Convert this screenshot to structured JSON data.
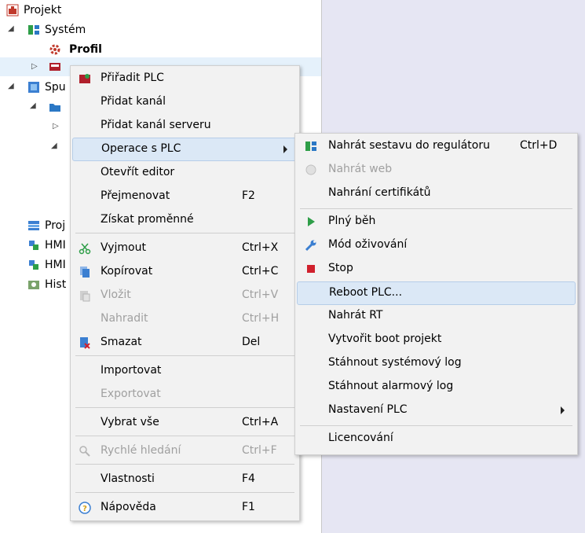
{
  "tree": {
    "root": "Projekt",
    "system": "Systém",
    "profile": "Profil",
    "spu": "Spu",
    "proj": "Proj",
    "hm1": "HMI",
    "hm2": "HMI",
    "hist": "Hist"
  },
  "context_menu": {
    "assign_plc": "Přiřadit PLC",
    "add_channel": "Přidat kanál",
    "add_server_channel": "Přidat kanál serveru",
    "plc_operations": "Operace s PLC",
    "open_editor": "Otevřít editor",
    "rename": "Přejmenovat",
    "rename_sc": "F2",
    "get_variables": "Získat proměnné",
    "cut": "Vyjmout",
    "cut_sc": "Ctrl+X",
    "copy": "Kopírovat",
    "copy_sc": "Ctrl+C",
    "paste": "Vložit",
    "paste_sc": "Ctrl+V",
    "replace": "Nahradit",
    "replace_sc": "Ctrl+H",
    "delete": "Smazat",
    "delete_sc": "Del",
    "import": "Importovat",
    "export": "Exportovat",
    "select_all": "Vybrat vše",
    "select_all_sc": "Ctrl+A",
    "quick_search": "Rychlé hledání",
    "quick_search_sc": "Ctrl+F",
    "properties": "Vlastnosti",
    "properties_sc": "F4",
    "help": "Nápověda",
    "help_sc": "F1"
  },
  "submenu": {
    "upload_config": "Nahrát sestavu do regulátoru",
    "upload_config_sc": "Ctrl+D",
    "upload_web": "Nahrát web",
    "upload_certs": "Nahrání certifikátů",
    "full_run": "Plný běh",
    "debug_mode": "Mód oživování",
    "stop": "Stop",
    "reboot": "Reboot PLC...",
    "upload_rt": "Nahrát RT",
    "create_boot": "Vytvořit boot projekt",
    "download_syslog": "Stáhnout systémový log",
    "download_alarmlog": "Stáhnout alarmový log",
    "plc_settings": "Nastavení PLC",
    "licensing": "Licencování"
  },
  "colors": {
    "right_panel": "#e6e6f3",
    "menu_bg": "#f2f2f2",
    "highlight": "#dbe8f6",
    "disabled_text": "#a0a0a0"
  }
}
